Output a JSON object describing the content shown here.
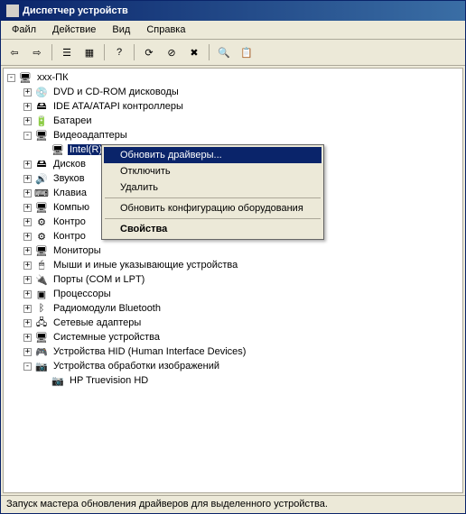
{
  "title": "Диспетчер устройств",
  "menu": {
    "file": "Файл",
    "action": "Действие",
    "view": "Вид",
    "help": "Справка"
  },
  "tree": {
    "root": "xxx-ПК",
    "nodes": [
      {
        "icon": "💿",
        "label": "DVD и CD-ROM дисководы",
        "indent": 1,
        "exp": "+"
      },
      {
        "icon": "🖴",
        "label": "IDE ATA/ATAPI контроллеры",
        "indent": 1,
        "exp": "+"
      },
      {
        "icon": "🔋",
        "label": "Батареи",
        "indent": 1,
        "exp": "+"
      },
      {
        "icon": "🖥",
        "label": "Видеоадаптеры",
        "indent": 1,
        "exp": "-"
      },
      {
        "icon": "🖥",
        "label": "Intel(R) HD Graphics",
        "indent": 2,
        "exp": "",
        "selected": true
      },
      {
        "icon": "🖴",
        "label": "Дисков",
        "indent": 1,
        "exp": "+"
      },
      {
        "icon": "🔊",
        "label": "Звуков",
        "indent": 1,
        "exp": "+"
      },
      {
        "icon": "⌨",
        "label": "Клавиа",
        "indent": 1,
        "exp": "+"
      },
      {
        "icon": "🖥",
        "label": "Компью",
        "indent": 1,
        "exp": "+"
      },
      {
        "icon": "⚙",
        "label": "Контро",
        "indent": 1,
        "exp": "+"
      },
      {
        "icon": "⚙",
        "label": "Контро",
        "indent": 1,
        "exp": "+"
      },
      {
        "icon": "🖥",
        "label": "Мониторы",
        "indent": 1,
        "exp": "+"
      },
      {
        "icon": "🖱",
        "label": "Мыши и иные указывающие устройства",
        "indent": 1,
        "exp": "+"
      },
      {
        "icon": "🔌",
        "label": "Порты (COM и LPT)",
        "indent": 1,
        "exp": "+"
      },
      {
        "icon": "▣",
        "label": "Процессоры",
        "indent": 1,
        "exp": "+"
      },
      {
        "icon": "ᛒ",
        "label": "Радиомодули Bluetooth",
        "indent": 1,
        "exp": "+"
      },
      {
        "icon": "🖧",
        "label": "Сетевые адаптеры",
        "indent": 1,
        "exp": "+"
      },
      {
        "icon": "🖥",
        "label": "Системные устройства",
        "indent": 1,
        "exp": "+"
      },
      {
        "icon": "🎮",
        "label": "Устройства HID (Human Interface Devices)",
        "indent": 1,
        "exp": "+"
      },
      {
        "icon": "📷",
        "label": "Устройства обработки изображений",
        "indent": 1,
        "exp": "-"
      },
      {
        "icon": "📷",
        "label": "HP Truevision HD",
        "indent": 2,
        "exp": ""
      }
    ]
  },
  "ctx": {
    "update": "Обновить драйверы...",
    "disable": "Отключить",
    "delete": "Удалить",
    "refresh": "Обновить конфигурацию оборудования",
    "properties": "Свойства"
  },
  "status": "Запуск мастера обновления драйверов для выделенного устройства."
}
